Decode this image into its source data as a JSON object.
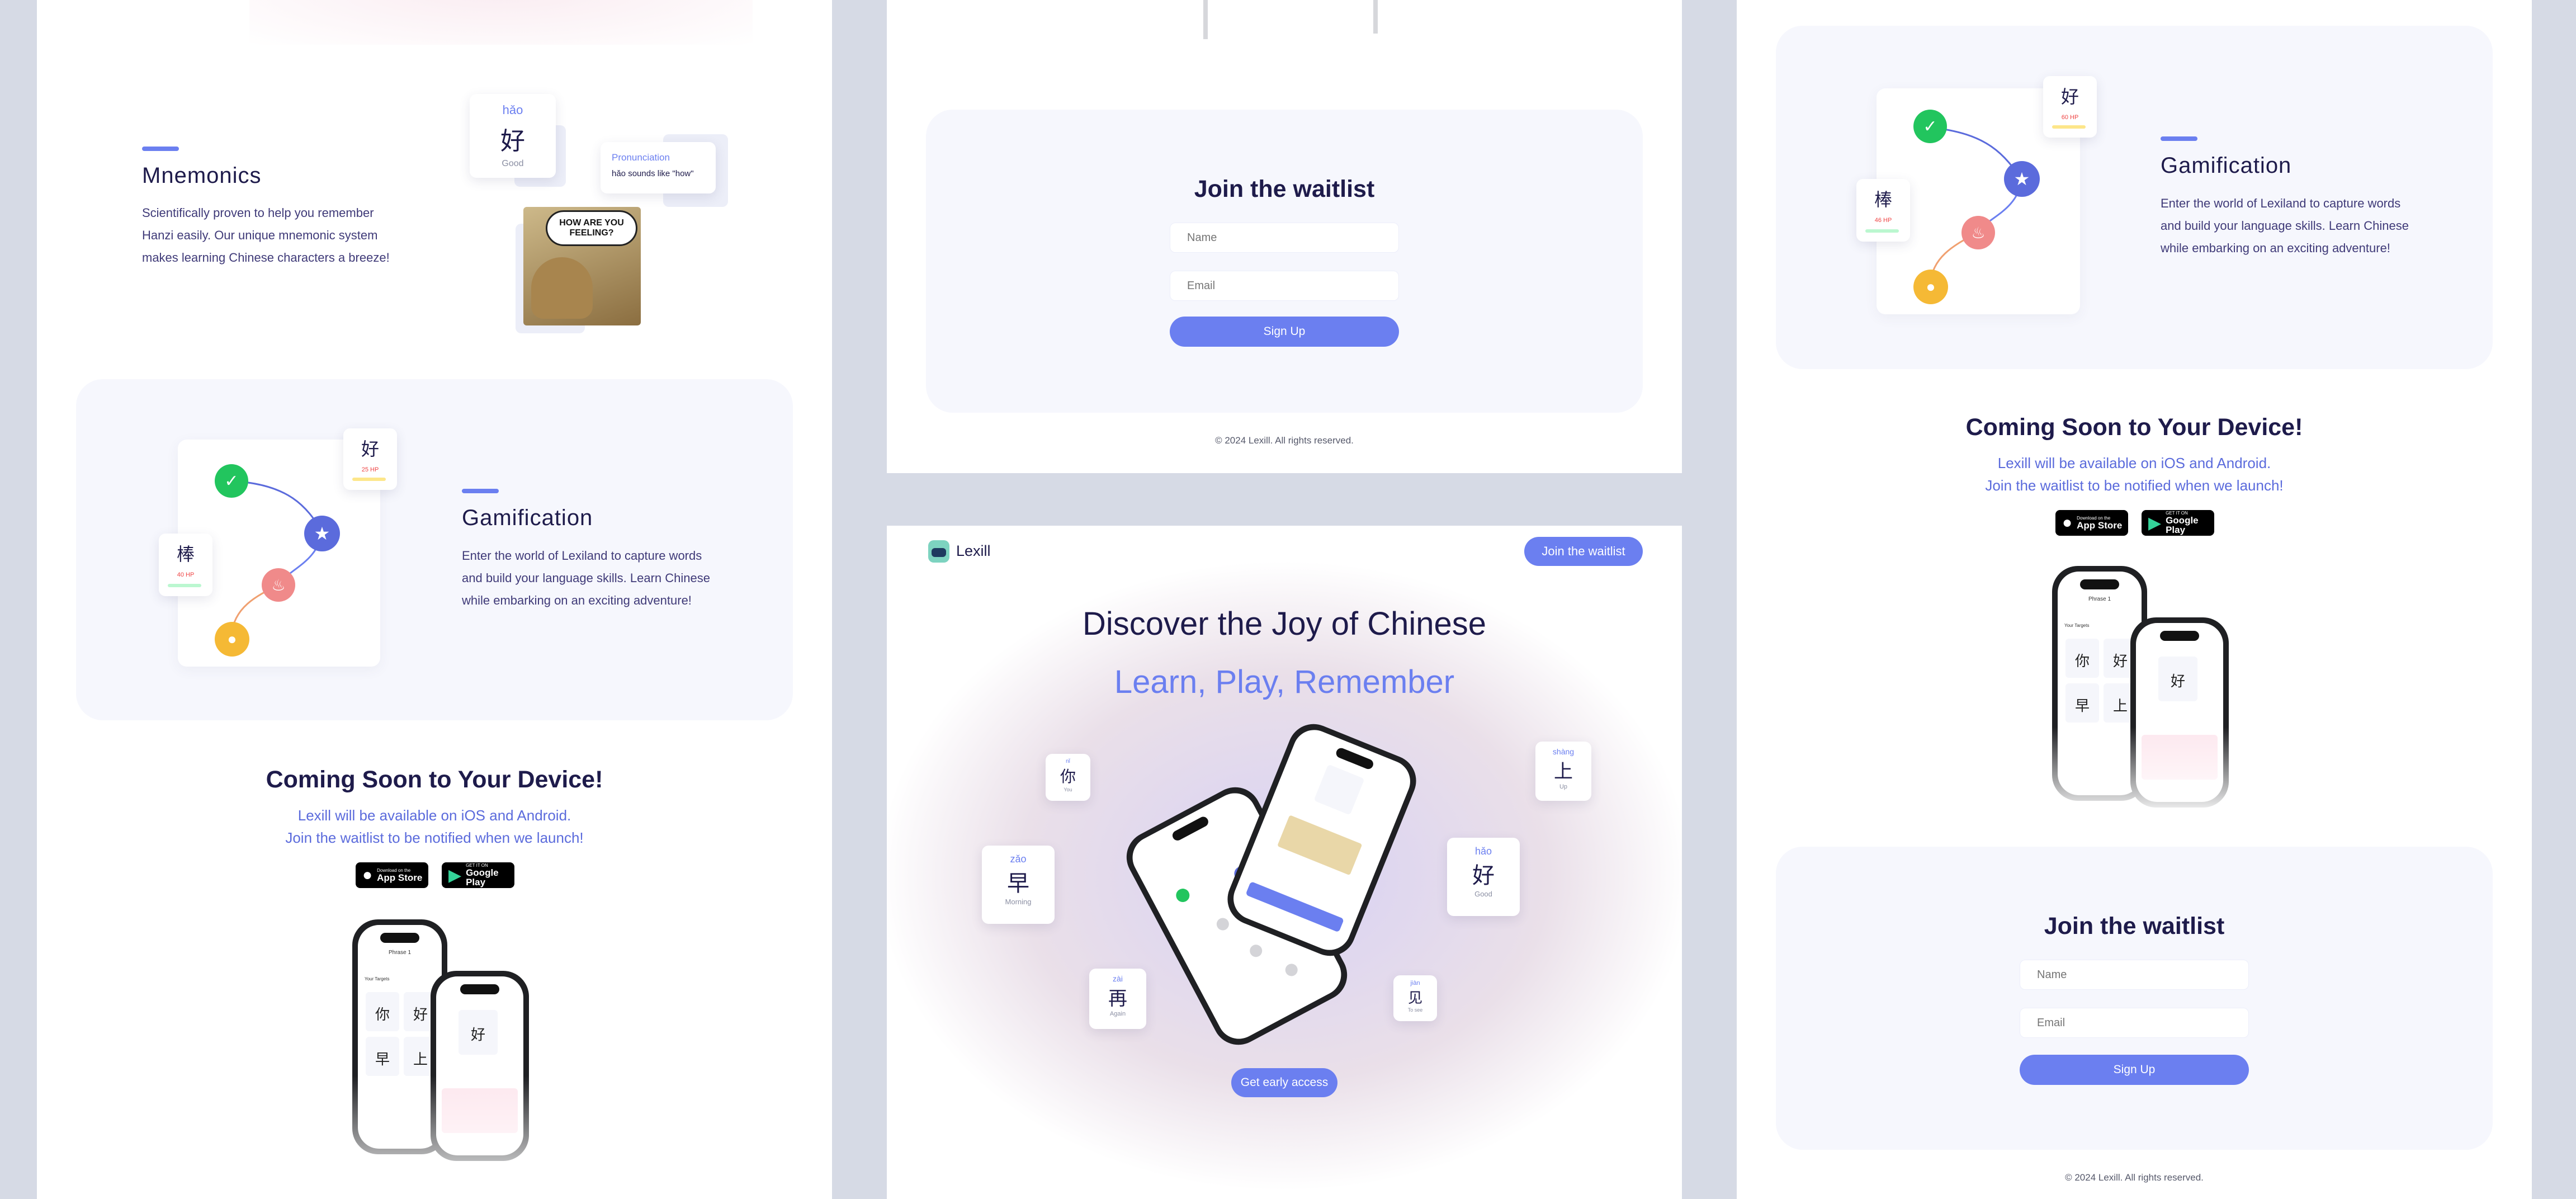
{
  "mnemonics": {
    "title": "Mnemonics",
    "description": [
      "Scientifically proven to help you remember",
      "Hanzi easily. Our unique mnemonic system",
      "makes learning Chinese characters a breeze!"
    ],
    "card": {
      "pinyin": "hǎo",
      "hanzi": "好",
      "meaning": "Good"
    },
    "pron_label": "Pronunciation",
    "pron_text": "hǎo sounds like \"how\"",
    "image_text": "HOW ARE YOU FEELING?"
  },
  "gamification": {
    "title": "Gamification",
    "description": [
      "Enter the world of Lexiland to capture words",
      "and build your language skills. Learn Chinese",
      "while embarking on an exciting adventure!"
    ],
    "card_top": {
      "hanzi": "好",
      "stat": "25 HP"
    },
    "card_left": {
      "hanzi": "棒",
      "stat": "40 HP"
    },
    "card_top_right": {
      "hanzi": "好",
      "stat": "60 HP"
    },
    "card_left_right": {
      "hanzi": "棒",
      "stat": "46 HP"
    }
  },
  "coming_soon": {
    "title": "Coming Soon to Your Device!",
    "line1": "Lexill will be available on iOS and Android.",
    "line2": "Join the waitlist to be notified when we launch!",
    "app_store_small": "Download on the",
    "app_store_big": "App Store",
    "google_small": "GET IT ON",
    "google_big": "Google Play"
  },
  "phone_preview": {
    "title": "Phrase 1",
    "subtitle": "Your Targets",
    "chars": [
      "你",
      "好",
      "早",
      "上"
    ],
    "right_char": "好"
  },
  "waitlist": {
    "title": "Join the waitlist",
    "name_placeholder": "Name",
    "email_placeholder": "Email",
    "button": "Sign Up"
  },
  "footer": {
    "copyright": "© 2024 Lexill. All rights reserved."
  },
  "hero": {
    "brand": "Lexill",
    "nav_button": "Join the waitlist",
    "title": "Discover the Joy of Chinese",
    "subtitle": "Learn, Play, Remember",
    "cta": "Get early access",
    "cards": [
      {
        "pinyin": "nǐ",
        "hanzi": "你",
        "meaning": "You"
      },
      {
        "pinyin": "zǎo",
        "hanzi": "早",
        "meaning": "Morning"
      },
      {
        "pinyin": "zài",
        "hanzi": "再",
        "meaning": "Again"
      },
      {
        "pinyin": "shàng",
        "hanzi": "上",
        "meaning": "Up"
      },
      {
        "pinyin": "hǎo",
        "hanzi": "好",
        "meaning": "Good"
      },
      {
        "pinyin": "jiàn",
        "hanzi": "见",
        "meaning": "To see"
      }
    ]
  },
  "colors": {
    "accent": "#6b7ff0",
    "dark": "#1e1b4b",
    "card": "#f6f7fd",
    "background": "#d6dae5"
  }
}
